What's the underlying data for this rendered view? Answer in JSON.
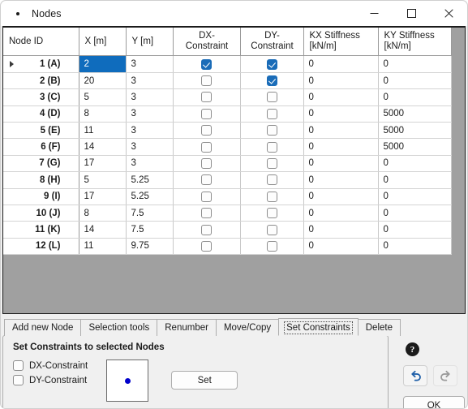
{
  "window": {
    "title": "Nodes",
    "icon": "node-dot-icon",
    "minimize_label": "—",
    "maximize_label": "□",
    "close_label": "✕"
  },
  "table": {
    "columns": [
      {
        "label": "Node ID",
        "key": "node_id"
      },
      {
        "label": "X [m]",
        "key": "x"
      },
      {
        "label": "Y [m]",
        "key": "y"
      },
      {
        "label": "DX-Constraint",
        "key": "dx"
      },
      {
        "label": "DY-Constraint",
        "key": "dy"
      },
      {
        "label": "KX Stiffness [kN/m]",
        "key": "kx"
      },
      {
        "label": "KY Stiffness [kN/m]",
        "key": "ky"
      }
    ],
    "rows": [
      {
        "node_id": "1 (A)",
        "x": "2",
        "y": "3",
        "dx": true,
        "dy": true,
        "kx": "0",
        "ky": "0",
        "selected": true,
        "marker": true
      },
      {
        "node_id": "2 (B)",
        "x": "20",
        "y": "3",
        "dx": false,
        "dy": true,
        "kx": "0",
        "ky": "0",
        "selected": false,
        "marker": false
      },
      {
        "node_id": "3 (C)",
        "x": "5",
        "y": "3",
        "dx": false,
        "dy": false,
        "kx": "0",
        "ky": "0",
        "selected": false,
        "marker": false
      },
      {
        "node_id": "4 (D)",
        "x": "8",
        "y": "3",
        "dx": false,
        "dy": false,
        "kx": "0",
        "ky": "5000",
        "selected": false,
        "marker": false
      },
      {
        "node_id": "5 (E)",
        "x": "11",
        "y": "3",
        "dx": false,
        "dy": false,
        "kx": "0",
        "ky": "5000",
        "selected": false,
        "marker": false
      },
      {
        "node_id": "6 (F)",
        "x": "14",
        "y": "3",
        "dx": false,
        "dy": false,
        "kx": "0",
        "ky": "5000",
        "selected": false,
        "marker": false
      },
      {
        "node_id": "7 (G)",
        "x": "17",
        "y": "3",
        "dx": false,
        "dy": false,
        "kx": "0",
        "ky": "0",
        "selected": false,
        "marker": false
      },
      {
        "node_id": "8 (H)",
        "x": "5",
        "y": "5.25",
        "dx": false,
        "dy": false,
        "kx": "0",
        "ky": "0",
        "selected": false,
        "marker": false
      },
      {
        "node_id": "9 (I)",
        "x": "17",
        "y": "5.25",
        "dx": false,
        "dy": false,
        "kx": "0",
        "ky": "0",
        "selected": false,
        "marker": false
      },
      {
        "node_id": "10 (J)",
        "x": "8",
        "y": "7.5",
        "dx": false,
        "dy": false,
        "kx": "0",
        "ky": "0",
        "selected": false,
        "marker": false
      },
      {
        "node_id": "11 (K)",
        "x": "14",
        "y": "7.5",
        "dx": false,
        "dy": false,
        "kx": "0",
        "ky": "0",
        "selected": false,
        "marker": false
      },
      {
        "node_id": "12 (L)",
        "x": "11",
        "y": "9.75",
        "dx": false,
        "dy": false,
        "kx": "0",
        "ky": "0",
        "selected": false,
        "marker": false
      }
    ]
  },
  "tabs": [
    {
      "label": "Add new Node",
      "active": false
    },
    {
      "label": "Selection tools",
      "active": false
    },
    {
      "label": "Renumber",
      "active": false
    },
    {
      "label": "Move/Copy",
      "active": false
    },
    {
      "label": "Set Constraints",
      "active": true
    },
    {
      "label": "Delete",
      "active": false
    }
  ],
  "panel": {
    "title": "Set Constraints to selected Nodes",
    "checkboxes": [
      {
        "label": "DX-Constraint",
        "checked": false
      },
      {
        "label": "DY-Constraint",
        "checked": false
      }
    ],
    "preview": {
      "name": "node-preview",
      "dot_color": "#0000cc"
    },
    "set_button": "Set"
  },
  "actions": {
    "help_label": "?",
    "undo_name": "undo-icon",
    "redo_name": "redo-icon",
    "ok_label": "OK"
  },
  "colors": {
    "selection": "#0f6cbd",
    "checkbox_checked": "#1a6cb8",
    "table_background": "#a0a0a0",
    "undo_active": "#1f5fa8",
    "redo_disabled": "#9a9a9a"
  }
}
